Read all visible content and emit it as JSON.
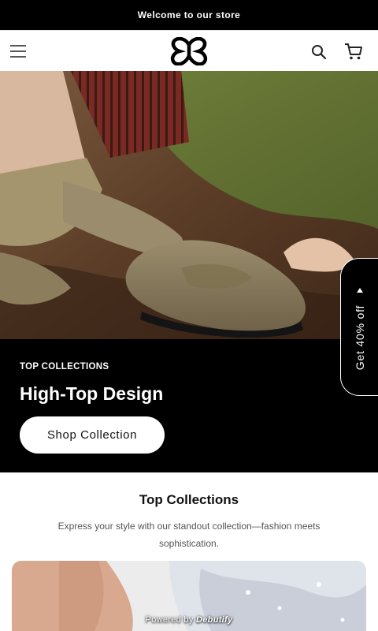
{
  "announcement": {
    "text": "Welcome to our store"
  },
  "header": {
    "menu_icon": "hamburger-menu-icon",
    "logo_icon": "butterfly-logo",
    "search_icon": "search-icon",
    "cart_icon": "cart-icon"
  },
  "hero": {
    "eyebrow": "TOP COLLECTIONS",
    "title": "High-Top Design",
    "button_label": "Shop Collection"
  },
  "promo": {
    "label": "Get 40% off"
  },
  "collections": {
    "title": "Top Collections",
    "description": "Express your style with our standout collection—fashion meets sophistication."
  },
  "footer": {
    "powered_prefix": "Powered by",
    "powered_brand": "Debutify"
  },
  "colors": {
    "accent": "#000000",
    "background": "#ffffff",
    "muted_text": "#555555"
  }
}
